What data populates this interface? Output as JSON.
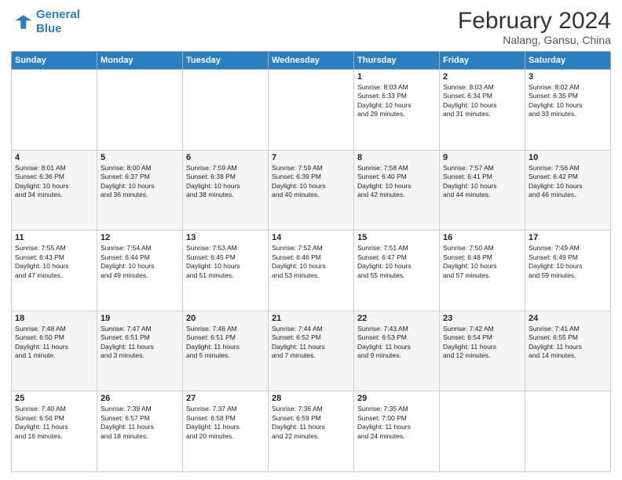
{
  "header": {
    "logo_line1": "General",
    "logo_line2": "Blue",
    "title": "February 2024",
    "subtitle": "Nalang, Gansu, China"
  },
  "days_of_week": [
    "Sunday",
    "Monday",
    "Tuesday",
    "Wednesday",
    "Thursday",
    "Friday",
    "Saturday"
  ],
  "weeks": [
    [
      {
        "day": "",
        "info": ""
      },
      {
        "day": "",
        "info": ""
      },
      {
        "day": "",
        "info": ""
      },
      {
        "day": "",
        "info": ""
      },
      {
        "day": "1",
        "info": "Sunrise: 8:03 AM\nSunset: 6:33 PM\nDaylight: 10 hours\nand 29 minutes."
      },
      {
        "day": "2",
        "info": "Sunrise: 8:03 AM\nSunset: 6:34 PM\nDaylight: 10 hours\nand 31 minutes."
      },
      {
        "day": "3",
        "info": "Sunrise: 8:02 AM\nSunset: 6:35 PM\nDaylight: 10 hours\nand 33 minutes."
      }
    ],
    [
      {
        "day": "4",
        "info": "Sunrise: 8:01 AM\nSunset: 6:36 PM\nDaylight: 10 hours\nand 34 minutes."
      },
      {
        "day": "5",
        "info": "Sunrise: 8:00 AM\nSunset: 6:37 PM\nDaylight: 10 hours\nand 36 minutes."
      },
      {
        "day": "6",
        "info": "Sunrise: 7:59 AM\nSunset: 6:38 PM\nDaylight: 10 hours\nand 38 minutes."
      },
      {
        "day": "7",
        "info": "Sunrise: 7:59 AM\nSunset: 6:39 PM\nDaylight: 10 hours\nand 40 minutes."
      },
      {
        "day": "8",
        "info": "Sunrise: 7:58 AM\nSunset: 6:40 PM\nDaylight: 10 hours\nand 42 minutes."
      },
      {
        "day": "9",
        "info": "Sunrise: 7:57 AM\nSunset: 6:41 PM\nDaylight: 10 hours\nand 44 minutes."
      },
      {
        "day": "10",
        "info": "Sunrise: 7:56 AM\nSunset: 6:42 PM\nDaylight: 10 hours\nand 46 minutes."
      }
    ],
    [
      {
        "day": "11",
        "info": "Sunrise: 7:55 AM\nSunset: 6:43 PM\nDaylight: 10 hours\nand 47 minutes."
      },
      {
        "day": "12",
        "info": "Sunrise: 7:54 AM\nSunset: 6:44 PM\nDaylight: 10 hours\nand 49 minutes."
      },
      {
        "day": "13",
        "info": "Sunrise: 7:53 AM\nSunset: 6:45 PM\nDaylight: 10 hours\nand 51 minutes."
      },
      {
        "day": "14",
        "info": "Sunrise: 7:52 AM\nSunset: 6:46 PM\nDaylight: 10 hours\nand 53 minutes."
      },
      {
        "day": "15",
        "info": "Sunrise: 7:51 AM\nSunset: 6:47 PM\nDaylight: 10 hours\nand 55 minutes."
      },
      {
        "day": "16",
        "info": "Sunrise: 7:50 AM\nSunset: 6:48 PM\nDaylight: 10 hours\nand 57 minutes."
      },
      {
        "day": "17",
        "info": "Sunrise: 7:49 AM\nSunset: 6:49 PM\nDaylight: 10 hours\nand 59 minutes."
      }
    ],
    [
      {
        "day": "18",
        "info": "Sunrise: 7:48 AM\nSunset: 6:50 PM\nDaylight: 11 hours\nand 1 minute."
      },
      {
        "day": "19",
        "info": "Sunrise: 7:47 AM\nSunset: 6:51 PM\nDaylight: 11 hours\nand 3 minutes."
      },
      {
        "day": "20",
        "info": "Sunrise: 7:46 AM\nSunset: 6:51 PM\nDaylight: 11 hours\nand 5 minutes."
      },
      {
        "day": "21",
        "info": "Sunrise: 7:44 AM\nSunset: 6:52 PM\nDaylight: 11 hours\nand 7 minutes."
      },
      {
        "day": "22",
        "info": "Sunrise: 7:43 AM\nSunset: 6:53 PM\nDaylight: 11 hours\nand 9 minutes."
      },
      {
        "day": "23",
        "info": "Sunrise: 7:42 AM\nSunset: 6:54 PM\nDaylight: 11 hours\nand 12 minutes."
      },
      {
        "day": "24",
        "info": "Sunrise: 7:41 AM\nSunset: 6:55 PM\nDaylight: 11 hours\nand 14 minutes."
      }
    ],
    [
      {
        "day": "25",
        "info": "Sunrise: 7:40 AM\nSunset: 6:56 PM\nDaylight: 11 hours\nand 16 minutes."
      },
      {
        "day": "26",
        "info": "Sunrise: 7:39 AM\nSunset: 6:57 PM\nDaylight: 11 hours\nand 18 minutes."
      },
      {
        "day": "27",
        "info": "Sunrise: 7:37 AM\nSunset: 6:58 PM\nDaylight: 11 hours\nand 20 minutes."
      },
      {
        "day": "28",
        "info": "Sunrise: 7:36 AM\nSunset: 6:59 PM\nDaylight: 11 hours\nand 22 minutes."
      },
      {
        "day": "29",
        "info": "Sunrise: 7:35 AM\nSunset: 7:00 PM\nDaylight: 11 hours\nand 24 minutes."
      },
      {
        "day": "",
        "info": ""
      },
      {
        "day": "",
        "info": ""
      }
    ]
  ]
}
